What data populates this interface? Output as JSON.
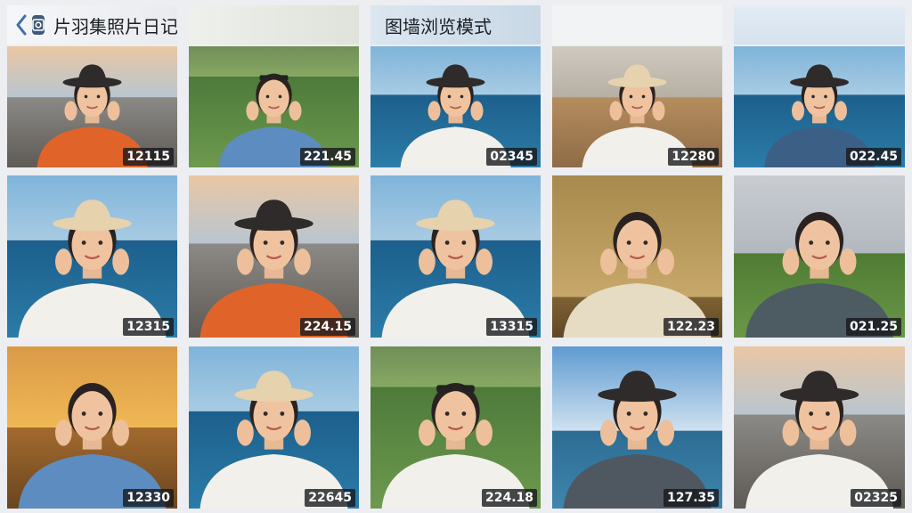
{
  "header": {
    "app_title": "片羽集照片日记软件",
    "mode_title": "图墙浏览模式"
  },
  "icons": {
    "back": "chevron-left-icon",
    "app": "camera-app-icon"
  },
  "grid": {
    "tiles": [
      {
        "timestamp": "12115",
        "scene": "beach-sunset",
        "outfit": "orange-vest",
        "hat": "bucket-dark"
      },
      {
        "timestamp": "221.45",
        "scene": "grass-field",
        "outfit": "blue-tee",
        "hat": "sunglasses"
      },
      {
        "timestamp": "02345",
        "scene": "sea-blue",
        "outfit": "white-tee",
        "hat": "bucket-dark"
      },
      {
        "timestamp": "12280",
        "scene": "beach-warm",
        "outfit": "white-tee",
        "hat": "bucket-beige"
      },
      {
        "timestamp": "022.45",
        "scene": "sea-blue",
        "outfit": "blue-shirt",
        "hat": "bucket-dark"
      },
      {
        "timestamp": "12315",
        "scene": "sea-blue",
        "outfit": "white-tee",
        "hat": "bucket-beige"
      },
      {
        "timestamp": "224.15",
        "scene": "beach-sunset",
        "outfit": "orange-vest",
        "hat": "bucket-dark"
      },
      {
        "timestamp": "13315",
        "scene": "sea-blue",
        "outfit": "white-tee",
        "hat": "bucket-beige"
      },
      {
        "timestamp": "122.23",
        "scene": "indoor-warm",
        "outfit": "cream-shirt",
        "hat": "none"
      },
      {
        "timestamp": "021.25",
        "scene": "grass-sky",
        "outfit": "grey-shirt",
        "hat": "none"
      },
      {
        "timestamp": "12330",
        "scene": "golden-sunset",
        "outfit": "blue-tee",
        "hat": "none"
      },
      {
        "timestamp": "22645",
        "scene": "sea-blue",
        "outfit": "white-tee",
        "hat": "bucket-beige"
      },
      {
        "timestamp": "224.18",
        "scene": "grass-field",
        "outfit": "white-tee",
        "hat": "sunglasses"
      },
      {
        "timestamp": "127.35",
        "scene": "sea-clouds",
        "outfit": "grey-jacket",
        "hat": "bucket-dark"
      },
      {
        "timestamp": "02325",
        "scene": "beach-sunset",
        "outfit": "white-tee",
        "hat": "bucket-dark"
      }
    ]
  }
}
